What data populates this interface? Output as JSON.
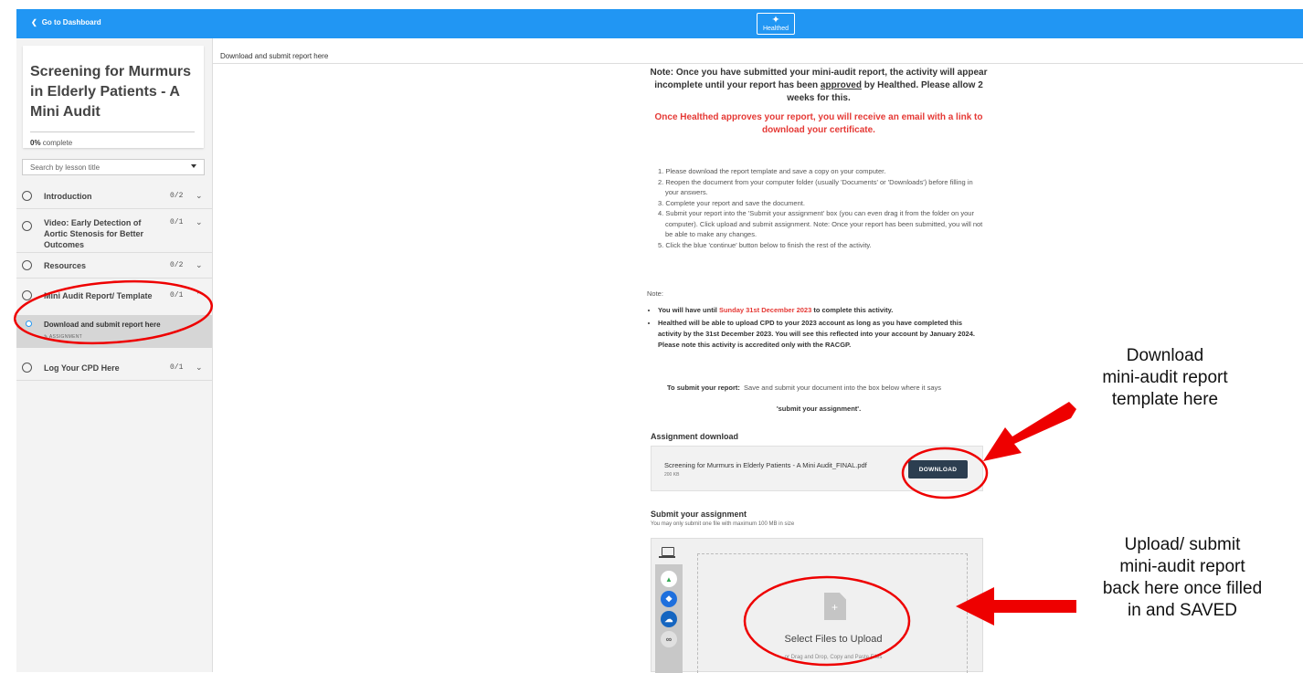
{
  "topbar": {
    "back_label": "Go to Dashboard",
    "logo_text": "Healthed"
  },
  "course": {
    "title": "Screening for Murmurs in Elderly Patients - A Mini Audit",
    "progress_pct": "0%",
    "progress_suffix": "complete"
  },
  "search": {
    "placeholder": "Search by lesson title"
  },
  "lessons": [
    {
      "label": "Introduction",
      "count": "0/2"
    },
    {
      "label": "Video: Early Detection of Aortic Stenosis for Better Outcomes",
      "count": "0/1"
    },
    {
      "label": "Resources",
      "count": "0/2"
    },
    {
      "label": "Mini Audit Report/ Template",
      "count": "0/1"
    },
    {
      "label": "Log Your CPD Here",
      "count": "0/1"
    }
  ],
  "active_sublesson": {
    "title": "Download and submit report here",
    "type": "ASSIGNMENT"
  },
  "content": {
    "header": "Download and submit report here",
    "note1_a": "Note: Once you have submitted your mini-audit report, the activity will appear incomplete until your report has been ",
    "note1_b": "approved",
    "note1_c": " by Healthed. Please allow 2 weeks for this.",
    "note2": "Once Healthed approves your report, you will receive an email with a link to download your certificate.",
    "steps": [
      "1. Please download the report template and save a copy on your computer.",
      "2. Reopen the document from your computer folder (usually 'Documents' or 'Downloads') before filling in your answers.",
      "3. Complete your report and save the document.",
      "4. Submit your report into the 'Submit your assignment' box (you can even drag it from the folder on your computer). Click upload and submit assignment. Note: Once your report has been submitted, you will not be able to make any changes.",
      "5. Click the blue 'continue' button below to finish the rest of the activity."
    ],
    "note_label": "Note:",
    "bullet1_a": "You will have until ",
    "bullet1_date": "Sunday 31st December 2023",
    "bullet1_b": " to complete this activity.",
    "bullet2": "Healthed will be able to upload CPD to your 2023 account as long as you have completed this activity by the 31st December 2023. You will see this reflected into your account by January 2024. Please note this activity is accredited only with the RACGP.",
    "submit_label": "To submit your report:",
    "submit_text": "Save and submit your document into the box below where it says",
    "submit_quote": "'submit your assignment'."
  },
  "download": {
    "heading": "Assignment download",
    "filename": "Screening for Murmurs in Elderly Patients - A Mini Audit_FINAL.pdf",
    "size": "200 KB",
    "button": "DOWNLOAD"
  },
  "submit": {
    "heading": "Submit your assignment",
    "note": "You may only submit one file with maximum 100 MB in size",
    "select_label": "Select Files to Upload",
    "drag_text": "or Drag and Drop, Copy and Paste Files"
  },
  "annotations": {
    "download": [
      "Download",
      "mini-audit report",
      "template here"
    ],
    "upload": [
      "Upload/ submit",
      "mini-audit report",
      "back here once filled",
      "in and SAVED"
    ]
  },
  "colors": {
    "topbar": "#2196f3",
    "highlight": "#e53935",
    "button": "#2c3e50"
  },
  "icons": [
    "chevron-left-icon",
    "laptop-icon",
    "google-drive-icon",
    "dropbox-icon",
    "onedrive-icon",
    "link-icon",
    "file-plus-icon"
  ]
}
